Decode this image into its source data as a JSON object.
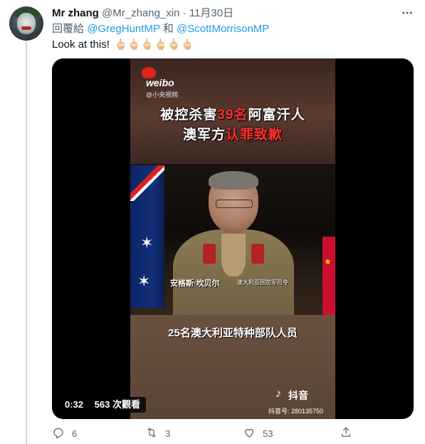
{
  "tweet": {
    "author_name": "Mr zhang",
    "author_handle": "@Mr_zhang_xin",
    "separator": "·",
    "timestamp": "11月30日",
    "more_icon": "more-icon",
    "reply_prefix": "回覆給",
    "mention1": "@GregHuntMP",
    "conjunction": "和",
    "mention2": "@ScottMorrisonMP",
    "text": "Look at this!",
    "emojis": "🖕🏻🖕🏻🖕🏻🖕🏻🖕🏻🖕🏻"
  },
  "video": {
    "watermark": "weibo",
    "watermark_sub": "@小央视频",
    "headline_line1_pre": "被控杀害",
    "headline_line1_red": "39名",
    "headline_line1_post": "阿富汗人",
    "headline_line2_pre": "澳军方",
    "headline_line2_red": "认罪致歉",
    "caption_name": "安格斯·坎贝尔",
    "caption_title": "澳大利亚国防军司令",
    "subtitle": "25名澳大利亚特种部队人员",
    "tiktok_label": "抖音",
    "tiktok_id": "抖音号: 280135750",
    "duration": "0:32",
    "views": "563 次觀看"
  },
  "actions": {
    "reply_count": "6",
    "retweet_count": "3",
    "like_count": "53"
  },
  "colors": {
    "link": "#1d9bf0",
    "secondary_text": "#536471",
    "accent_red": "#ff3030"
  }
}
